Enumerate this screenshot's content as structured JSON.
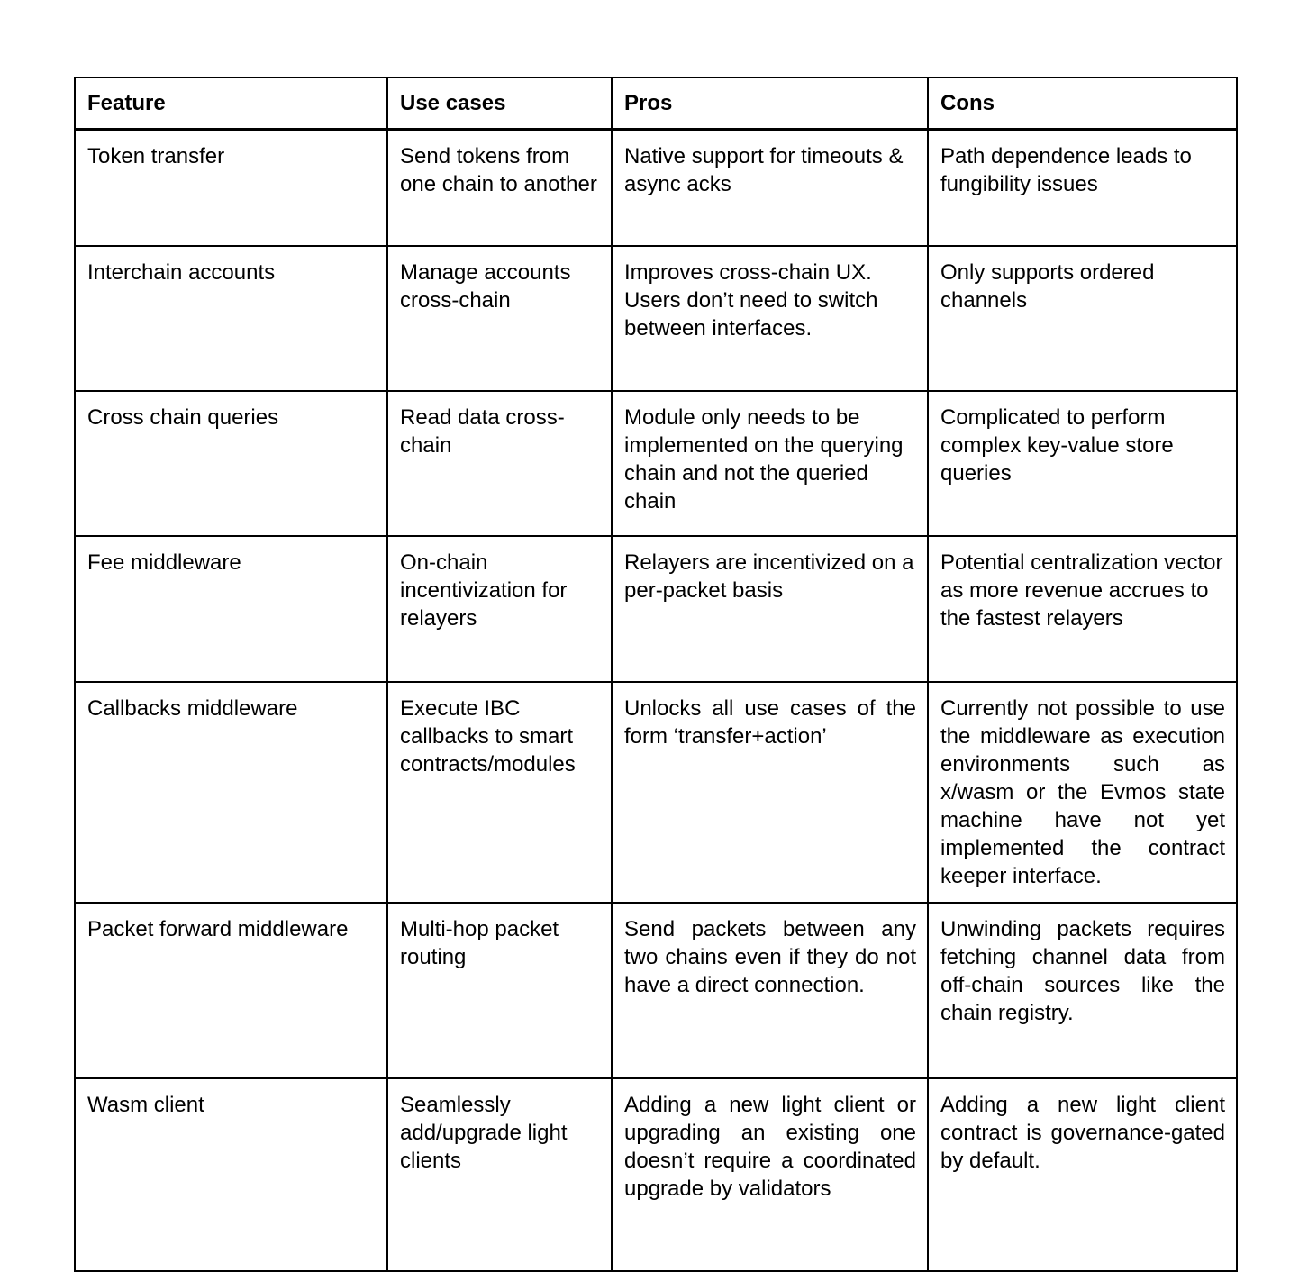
{
  "table": {
    "columns": [
      {
        "key": "feature",
        "label": "Feature"
      },
      {
        "key": "use_cases",
        "label": "Use cases"
      },
      {
        "key": "pros",
        "label": "Pros"
      },
      {
        "key": "cons",
        "label": "Cons"
      }
    ],
    "rows": [
      {
        "feature": "Token transfer",
        "use_cases": "Send tokens from one chain to another",
        "pros": "Native support for timeouts & async acks",
        "cons": "Path dependence leads to fungibility issues",
        "justified": false
      },
      {
        "feature": "Interchain accounts",
        "use_cases": "Manage accounts cross-chain",
        "pros": "Improves cross-chain UX. Users don’t need to switch between interfaces.",
        "cons": "Only supports ordered channels",
        "justified": false
      },
      {
        "feature": "Cross chain queries",
        "use_cases": "Read data cross-chain",
        "pros": "Module only needs to be implemented on the querying chain and not the queried chain",
        "cons": "Complicated to perform complex key-value store queries",
        "justified": false
      },
      {
        "feature": "Fee middleware",
        "use_cases": "On-chain incentivization for relayers",
        "pros": "Relayers are incentivized on a per-packet basis",
        "cons": "Potential centralization vector as more revenue accrues to the fastest relayers",
        "justified": false
      },
      {
        "feature": "Callbacks middleware",
        "use_cases": "Execute IBC callbacks to smart contracts/modules",
        "pros": "Unlocks all use cases of the form ‘transfer+action’",
        "cons": "Currently not possible to use the middleware as execution environments such as x/wasm or the Evmos state machine have not yet implemented the contract keeper interface.",
        "justified": true
      },
      {
        "feature": "Packet forward middleware",
        "use_cases": "Multi-hop packet routing",
        "pros": "Send packets between any two chains even if they do not have a direct connection.",
        "cons": "Unwinding packets requires fetching channel data from off-chain sources like the chain registry.",
        "justified": true
      },
      {
        "feature": "Wasm client",
        "use_cases": "Seamlessly add/upgrade light clients",
        "pros": "Adding a new light client or upgrading an existing one doesn’t require a coordinated upgrade by validators",
        "cons": "Adding a new light client contract is governance-gated by default.",
        "justified": true
      }
    ]
  },
  "colors": {
    "border": "#000000",
    "text": "#000000",
    "background": "#ffffff"
  }
}
